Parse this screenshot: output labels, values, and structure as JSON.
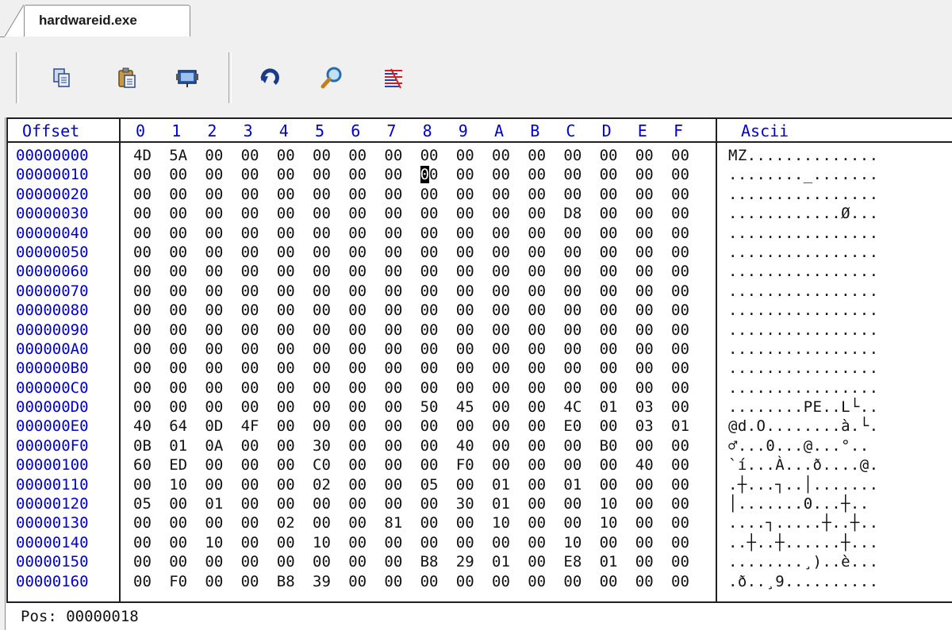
{
  "tab": {
    "title": "hardwareid.exe"
  },
  "toolbar": {
    "buttons": [
      {
        "icon": "copy-icon"
      },
      {
        "icon": "paste-icon"
      },
      {
        "icon": "select-all-icon"
      },
      {
        "icon": "redo-icon"
      },
      {
        "icon": "find-icon"
      },
      {
        "icon": "highlight-icon"
      }
    ]
  },
  "hex": {
    "offset_header": "Offset",
    "ascii_header": "Ascii",
    "columns": [
      "0",
      "1",
      "2",
      "3",
      "4",
      "5",
      "6",
      "7",
      "8",
      "9",
      "A",
      "B",
      "C",
      "D",
      "E",
      "F"
    ],
    "rows": [
      {
        "offset": "00000000",
        "bytes": [
          "4D",
          "5A",
          "00",
          "00",
          "00",
          "00",
          "00",
          "00",
          "00",
          "00",
          "00",
          "00",
          "00",
          "00",
          "00",
          "00"
        ],
        "ascii": "MZ.............."
      },
      {
        "offset": "00000010",
        "bytes": [
          "00",
          "00",
          "00",
          "00",
          "00",
          "00",
          "00",
          "00",
          "00",
          "00",
          "00",
          "00",
          "00",
          "00",
          "00",
          "00"
        ],
        "ascii": "........_......."
      },
      {
        "offset": "00000020",
        "bytes": [
          "00",
          "00",
          "00",
          "00",
          "00",
          "00",
          "00",
          "00",
          "00",
          "00",
          "00",
          "00",
          "00",
          "00",
          "00",
          "00"
        ],
        "ascii": "................"
      },
      {
        "offset": "00000030",
        "bytes": [
          "00",
          "00",
          "00",
          "00",
          "00",
          "00",
          "00",
          "00",
          "00",
          "00",
          "00",
          "00",
          "D8",
          "00",
          "00",
          "00"
        ],
        "ascii": "............Ø..."
      },
      {
        "offset": "00000040",
        "bytes": [
          "00",
          "00",
          "00",
          "00",
          "00",
          "00",
          "00",
          "00",
          "00",
          "00",
          "00",
          "00",
          "00",
          "00",
          "00",
          "00"
        ],
        "ascii": "................"
      },
      {
        "offset": "00000050",
        "bytes": [
          "00",
          "00",
          "00",
          "00",
          "00",
          "00",
          "00",
          "00",
          "00",
          "00",
          "00",
          "00",
          "00",
          "00",
          "00",
          "00"
        ],
        "ascii": "................"
      },
      {
        "offset": "00000060",
        "bytes": [
          "00",
          "00",
          "00",
          "00",
          "00",
          "00",
          "00",
          "00",
          "00",
          "00",
          "00",
          "00",
          "00",
          "00",
          "00",
          "00"
        ],
        "ascii": "................"
      },
      {
        "offset": "00000070",
        "bytes": [
          "00",
          "00",
          "00",
          "00",
          "00",
          "00",
          "00",
          "00",
          "00",
          "00",
          "00",
          "00",
          "00",
          "00",
          "00",
          "00"
        ],
        "ascii": "................"
      },
      {
        "offset": "00000080",
        "bytes": [
          "00",
          "00",
          "00",
          "00",
          "00",
          "00",
          "00",
          "00",
          "00",
          "00",
          "00",
          "00",
          "00",
          "00",
          "00",
          "00"
        ],
        "ascii": "................"
      },
      {
        "offset": "00000090",
        "bytes": [
          "00",
          "00",
          "00",
          "00",
          "00",
          "00",
          "00",
          "00",
          "00",
          "00",
          "00",
          "00",
          "00",
          "00",
          "00",
          "00"
        ],
        "ascii": "................"
      },
      {
        "offset": "000000A0",
        "bytes": [
          "00",
          "00",
          "00",
          "00",
          "00",
          "00",
          "00",
          "00",
          "00",
          "00",
          "00",
          "00",
          "00",
          "00",
          "00",
          "00"
        ],
        "ascii": "................"
      },
      {
        "offset": "000000B0",
        "bytes": [
          "00",
          "00",
          "00",
          "00",
          "00",
          "00",
          "00",
          "00",
          "00",
          "00",
          "00",
          "00",
          "00",
          "00",
          "00",
          "00"
        ],
        "ascii": "................"
      },
      {
        "offset": "000000C0",
        "bytes": [
          "00",
          "00",
          "00",
          "00",
          "00",
          "00",
          "00",
          "00",
          "00",
          "00",
          "00",
          "00",
          "00",
          "00",
          "00",
          "00"
        ],
        "ascii": "................"
      },
      {
        "offset": "000000D0",
        "bytes": [
          "00",
          "00",
          "00",
          "00",
          "00",
          "00",
          "00",
          "00",
          "50",
          "45",
          "00",
          "00",
          "4C",
          "01",
          "03",
          "00"
        ],
        "ascii": "........PE..L└.."
      },
      {
        "offset": "000000E0",
        "bytes": [
          "40",
          "64",
          "0D",
          "4F",
          "00",
          "00",
          "00",
          "00",
          "00",
          "00",
          "00",
          "00",
          "E0",
          "00",
          "03",
          "01"
        ],
        "ascii": "@d.O........à.└."
      },
      {
        "offset": "000000F0",
        "bytes": [
          "0B",
          "01",
          "0A",
          "00",
          "00",
          "30",
          "00",
          "00",
          "00",
          "40",
          "00",
          "00",
          "00",
          "B0",
          "00",
          "00"
        ],
        "ascii": "♂...0...@...°.."
      },
      {
        "offset": "00000100",
        "bytes": [
          "60",
          "ED",
          "00",
          "00",
          "00",
          "C0",
          "00",
          "00",
          "00",
          "F0",
          "00",
          "00",
          "00",
          "00",
          "40",
          "00"
        ],
        "ascii": "`í...À...ð....@."
      },
      {
        "offset": "00000110",
        "bytes": [
          "00",
          "10",
          "00",
          "00",
          "00",
          "02",
          "00",
          "00",
          "05",
          "00",
          "01",
          "00",
          "01",
          "00",
          "00",
          "00"
        ],
        "ascii": ".┼...┐..│......."
      },
      {
        "offset": "00000120",
        "bytes": [
          "05",
          "00",
          "01",
          "00",
          "00",
          "00",
          "00",
          "00",
          "00",
          "30",
          "01",
          "00",
          "00",
          "10",
          "00",
          "00"
        ],
        "ascii": "│.......0...┼.."
      },
      {
        "offset": "00000130",
        "bytes": [
          "00",
          "00",
          "00",
          "00",
          "02",
          "00",
          "00",
          "81",
          "00",
          "00",
          "10",
          "00",
          "00",
          "10",
          "00",
          "00"
        ],
        "ascii": "....┐.....┼..┼.."
      },
      {
        "offset": "00000140",
        "bytes": [
          "00",
          "00",
          "10",
          "00",
          "00",
          "10",
          "00",
          "00",
          "00",
          "00",
          "00",
          "00",
          "10",
          "00",
          "00",
          "00"
        ],
        "ascii": "..┼..┼......┼..."
      },
      {
        "offset": "00000150",
        "bytes": [
          "00",
          "00",
          "00",
          "00",
          "00",
          "00",
          "00",
          "00",
          "B8",
          "29",
          "01",
          "00",
          "E8",
          "01",
          "00",
          "00"
        ],
        "ascii": "........¸)..è..."
      },
      {
        "offset": "00000160",
        "bytes": [
          "00",
          "F0",
          "00",
          "00",
          "B8",
          "39",
          "00",
          "00",
          "00",
          "00",
          "00",
          "00",
          "00",
          "00",
          "00",
          "00"
        ],
        "ascii": ".ð..¸9.........."
      }
    ]
  },
  "status": {
    "label": "Pos:",
    "value": "00000018"
  }
}
